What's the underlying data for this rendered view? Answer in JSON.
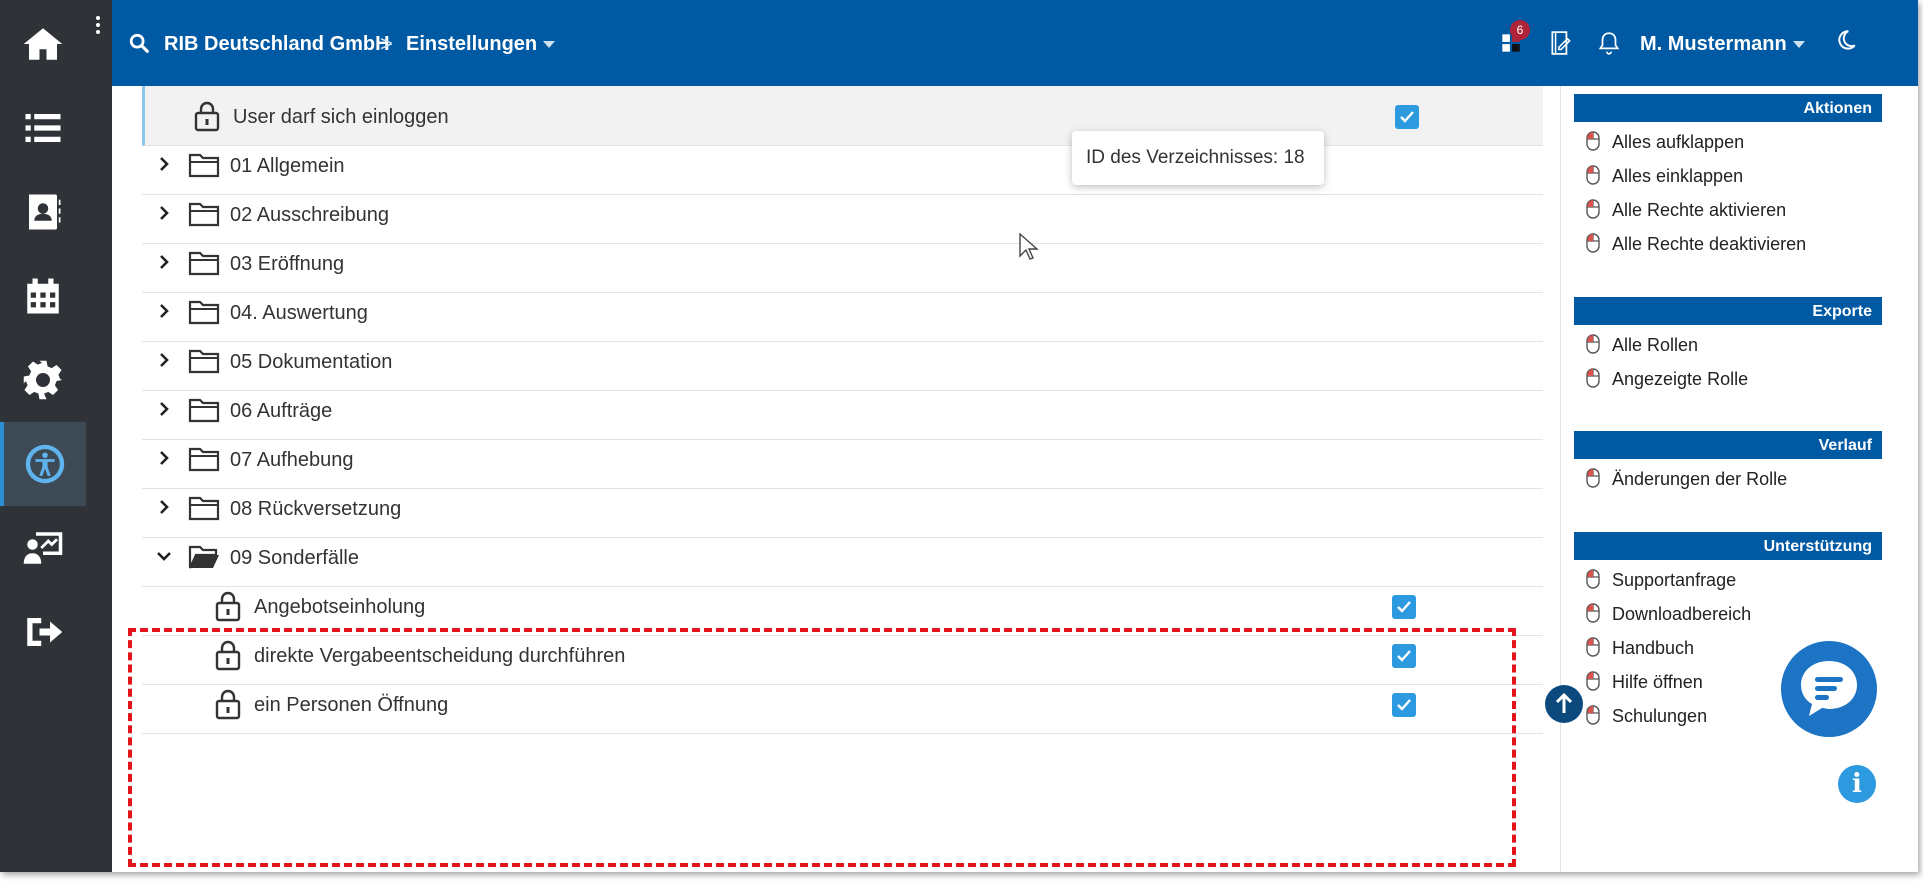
{
  "header": {
    "company": "RIB Deutschland GmbH",
    "separator": ">",
    "section": "Einstellungen",
    "notification_count": "6",
    "user": "M. Mustermann"
  },
  "nav": {
    "items": [
      "home-icon",
      "list-icon",
      "contacts-icon",
      "calendar-icon",
      "settings-icon",
      "accessibility-icon",
      "presentation-icon",
      "logout-icon"
    ],
    "active": "accessibility-icon"
  },
  "tooltip": "ID des Verzeichnisses: 18",
  "tree": {
    "top_item": {
      "label": "User darf sich einloggen",
      "checked": true
    },
    "folders": [
      "01 Allgemein",
      "02 Ausschreibung",
      "03 Eröffnung",
      "04. Auswertung",
      "05 Dokumentation",
      "06 Aufträge",
      "07 Aufhebung",
      "08 Rückversetzung"
    ],
    "expanded_folder": "09 Sonderfälle",
    "expanded_items": [
      {
        "label": "Angebotseinholung",
        "checked": true
      },
      {
        "label": "direkte Vergabeentscheidung durchführen",
        "checked": true
      },
      {
        "label": "ein Personen Öffnung",
        "checked": true
      }
    ]
  },
  "sidebar": {
    "aktionen": {
      "title": "Aktionen",
      "items": [
        "Alles aufklappen",
        "Alles einklappen",
        "Alle Rechte aktivieren",
        "Alle Rechte deaktivieren"
      ]
    },
    "exporte": {
      "title": "Exporte",
      "items": [
        "Alle Rollen",
        "Angezeigte Rolle"
      ]
    },
    "verlauf": {
      "title": "Verlauf",
      "items": [
        "Änderungen der Rolle"
      ]
    },
    "unterstuetzung": {
      "title": "Unterstützung",
      "items": [
        "Supportanfrage",
        "Downloadbereich",
        "Handbuch",
        "Hilfe öffnen",
        "Schulungen"
      ]
    }
  },
  "colors": {
    "header": "#0059a3",
    "nav": "#2f3337",
    "checkbox": "#2d9ae0",
    "highlight": "#e3151a",
    "badge": "#b0243a"
  }
}
